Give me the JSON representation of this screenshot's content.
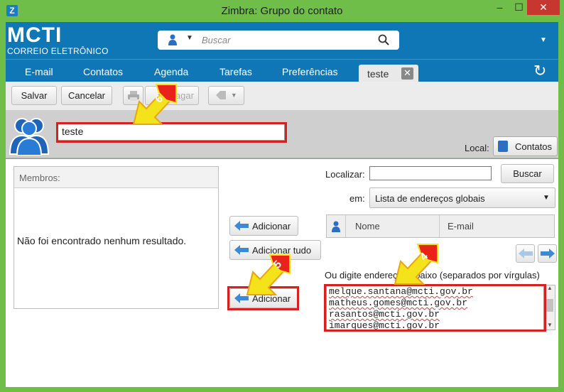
{
  "window": {
    "title": "Zimbra: Grupo do contato",
    "app_icon": "Z",
    "min": "‒",
    "max": "☐",
    "close": "✕"
  },
  "header": {
    "logo_main": "MCTI",
    "logo_sub": "CORREIO ELETRÔNICO",
    "search_placeholder": "Buscar"
  },
  "nav": {
    "tabs": [
      "E-mail",
      "Contatos",
      "Agenda",
      "Tarefas",
      "Preferências"
    ],
    "active_tab": "teste",
    "active_tab_close": "✕",
    "refresh": "↻"
  },
  "toolbar": {
    "save": "Salvar",
    "cancel": "Cancelar",
    "delete": "Apagar"
  },
  "group": {
    "name_value": "teste",
    "local_label": "Local:",
    "local_button": "Contatos"
  },
  "members": {
    "header": "Membros:",
    "empty_text": "Não foi encontrado nenhum resultado."
  },
  "actions": {
    "add": "Adicionar",
    "add_all": "Adicionar tudo",
    "add_typed": "Adicionar"
  },
  "search_panel": {
    "find_label": "Localizar:",
    "find_value": "",
    "find_button": "Buscar",
    "in_label": "em:",
    "in_value": "Lista de endereços globais",
    "col_name": "Nome",
    "col_email": "E-mail",
    "type_label": "Ou digite endereços abaixo (separados por vírgulas)"
  },
  "typed_emails": [
    "melque.santana@mcti.gov.br",
    "matheus.gomes@mcti.gov.br",
    "rasantos@mcti.gov.br",
    "imarques@mcti.gov.br"
  ],
  "annotations": [
    "6",
    "5",
    "4"
  ],
  "colors": {
    "frame": "#6fbe4a",
    "brand_blue": "#0f77b5",
    "highlight_red": "#d82020",
    "callout_yellow": "#f4e21a"
  }
}
